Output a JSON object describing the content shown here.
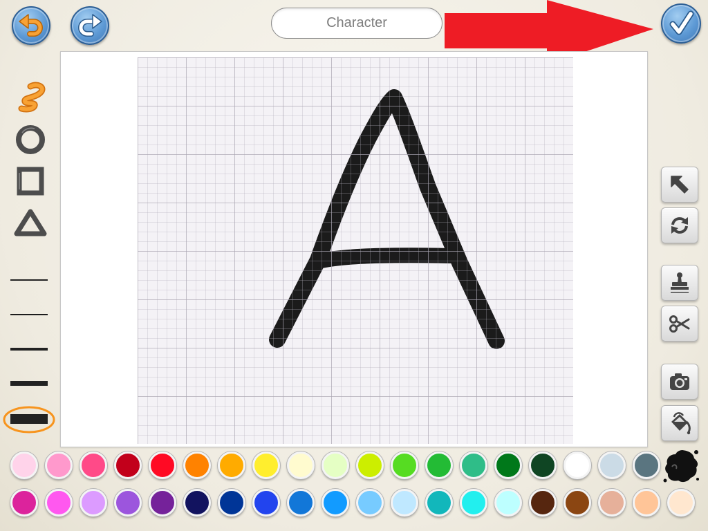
{
  "header": {
    "undo_icon": "undo-icon",
    "redo_icon": "redo-icon",
    "name_field": {
      "value": "Character"
    },
    "confirm_icon": "checkmark-icon"
  },
  "annotation": {
    "arrow_icon": "red-right-arrow-icon",
    "arrow_color": "#ee1c25"
  },
  "left_toolbar": {
    "shape_tools": [
      {
        "icon": "freehand-squiggle-icon",
        "selected": true
      },
      {
        "icon": "ellipse-icon",
        "selected": false
      },
      {
        "icon": "rectangle-icon",
        "selected": false
      },
      {
        "icon": "triangle-icon",
        "selected": false
      }
    ],
    "line_width_levels": [
      1,
      2,
      3,
      4,
      5
    ],
    "selected_line_width_level": 5,
    "selection_color": "#f7941d"
  },
  "right_toolbar": {
    "tools": [
      {
        "icon": "select-arrow-icon"
      },
      {
        "icon": "rotate-icon"
      },
      {
        "icon": "duplicate-stamp-icon"
      },
      {
        "icon": "cut-scissors-icon"
      },
      {
        "icon": "camera-icon"
      },
      {
        "icon": "paint-bucket-icon"
      }
    ]
  },
  "canvas": {
    "grid": true,
    "stroke_color": "#1b1b1b",
    "background_color": "#f4f2f6"
  },
  "palette": {
    "row1": [
      "#ffd3ea",
      "#ff99cc",
      "#ff4a88",
      "#c2001b",
      "#ff0a24",
      "#ff8200",
      "#ffab00",
      "#ffee2e",
      "#fffbcf",
      "#e5ffc4",
      "#ccee00",
      "#56dc22",
      "#23bb35",
      "#2fbd88",
      "#00781a",
      "#0f4523",
      "#ffffff",
      "#cbdbe6",
      "#5a7580"
    ],
    "row2": [
      "#dc239c",
      "#ff58ef",
      "#dc9bff",
      "#9c55dd",
      "#75229a",
      "#12135f",
      "#003597",
      "#2244ee",
      "#1277d8",
      "#129bff",
      "#77cbff",
      "#bfe8ff",
      "#12b7bb",
      "#22efee",
      "#bdffff",
      "#56260f",
      "#8b4612",
      "#e6b09a",
      "#ffc598",
      "#ffe7cf"
    ],
    "selected_color": "#000000",
    "selected_color_icon": "ink-splat-icon"
  }
}
